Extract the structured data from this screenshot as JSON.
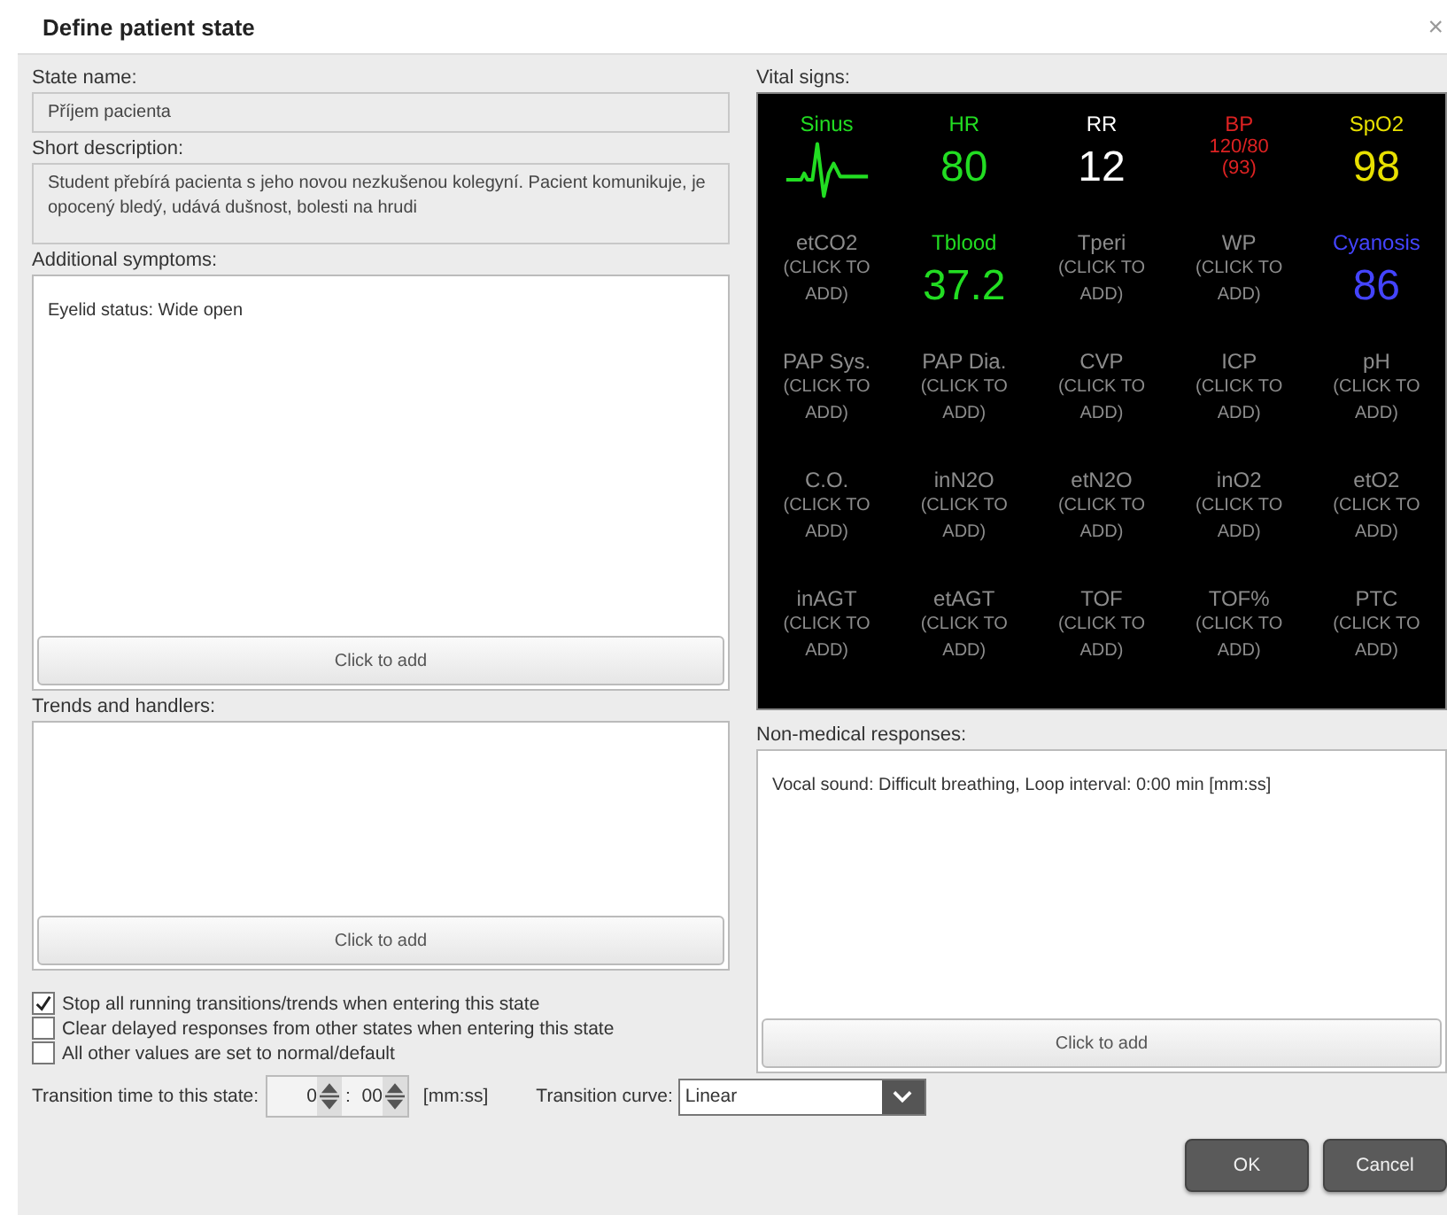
{
  "window": {
    "title": "Define patient state",
    "close": "×"
  },
  "state_name": {
    "label": "State name:",
    "value": "Příjem pacienta"
  },
  "short_description": {
    "label": "Short description:",
    "value": "Student přebírá pacienta s jeho novou nezkušenou kolegyní. Pacient komunikuje, je opocený bledý, udává dušnost, bolesti na hrudi"
  },
  "additional_symptoms": {
    "label": "Additional symptoms:",
    "items": [
      "Eyelid status: Wide open"
    ],
    "button": "Click to add"
  },
  "trends_and_handlers": {
    "label": "Trends and handlers:",
    "button": "Click to add"
  },
  "options": [
    {
      "label": "Stop all running transitions/trends when entering this state",
      "checked": true
    },
    {
      "label": "Clear delayed responses from other states when entering this state",
      "checked": false
    },
    {
      "label": "All other values are set to normal/default",
      "checked": false
    }
  ],
  "transition_time": {
    "label": "Transition time to this state:",
    "minutes": "0",
    "separator": ":",
    "seconds": "00",
    "unit": "[mm:ss]"
  },
  "transition_curve": {
    "label": "Transition curve:",
    "value": "Linear"
  },
  "vital_signs": {
    "label": "Vital signs:",
    "tiles": [
      {
        "kind": "ecg",
        "label": "Sinus",
        "color": "#22dd22"
      },
      {
        "kind": "value",
        "label": "HR",
        "value": "80",
        "color": "#22dd22"
      },
      {
        "kind": "value",
        "label": "RR",
        "value": "12",
        "color": "#ffffff"
      },
      {
        "kind": "pressure",
        "label": "BP",
        "value": "120/80",
        "sub": "(93)",
        "color": "#dd2222"
      },
      {
        "kind": "value",
        "label": "SpO2",
        "value": "98",
        "color": "#e8e000"
      },
      {
        "kind": "empty",
        "label": "etCO2",
        "value": "(CLICK TO ADD)",
        "color": "#8c8c8c"
      },
      {
        "kind": "value",
        "label": "Tblood",
        "value": "37.2",
        "color": "#22dd22"
      },
      {
        "kind": "empty",
        "label": "Tperi",
        "value": "(CLICK TO ADD)",
        "color": "#8c8c8c"
      },
      {
        "kind": "empty",
        "label": "WP",
        "value": "(CLICK TO ADD)",
        "color": "#8c8c8c"
      },
      {
        "kind": "value",
        "label": "Cyanosis",
        "value": "86",
        "color": "#4444ff"
      },
      {
        "kind": "empty",
        "label": "PAP Sys.",
        "value": "(CLICK TO ADD)",
        "color": "#8c8c8c"
      },
      {
        "kind": "empty",
        "label": "PAP Dia.",
        "value": "(CLICK TO ADD)",
        "color": "#8c8c8c"
      },
      {
        "kind": "empty",
        "label": "CVP",
        "value": "(CLICK TO ADD)",
        "color": "#8c8c8c"
      },
      {
        "kind": "empty",
        "label": "ICP",
        "value": "(CLICK TO ADD)",
        "color": "#8c8c8c"
      },
      {
        "kind": "empty",
        "label": "pH",
        "value": "(CLICK TO ADD)",
        "color": "#8c8c8c"
      },
      {
        "kind": "empty",
        "label": "C.O.",
        "value": "(CLICK TO ADD)",
        "color": "#8c8c8c"
      },
      {
        "kind": "empty",
        "label": "inN2O",
        "value": "(CLICK TO ADD)",
        "color": "#8c8c8c"
      },
      {
        "kind": "empty",
        "label": "etN2O",
        "value": "(CLICK TO ADD)",
        "color": "#8c8c8c"
      },
      {
        "kind": "empty",
        "label": "inO2",
        "value": "(CLICK TO ADD)",
        "color": "#8c8c8c"
      },
      {
        "kind": "empty",
        "label": "etO2",
        "value": "(CLICK TO ADD)",
        "color": "#8c8c8c"
      },
      {
        "kind": "empty",
        "label": "inAGT",
        "value": "(CLICK TO ADD)",
        "color": "#8c8c8c"
      },
      {
        "kind": "empty",
        "label": "etAGT",
        "value": "(CLICK TO ADD)",
        "color": "#8c8c8c"
      },
      {
        "kind": "empty",
        "label": "TOF",
        "value": "(CLICK TO ADD)",
        "color": "#8c8c8c"
      },
      {
        "kind": "empty",
        "label": "TOF%",
        "value": "(CLICK TO ADD)",
        "color": "#8c8c8c"
      },
      {
        "kind": "empty",
        "label": "PTC",
        "value": "(CLICK TO ADD)",
        "color": "#8c8c8c"
      }
    ]
  },
  "non_medical_responses": {
    "label": "Non-medical responses:",
    "items": [
      "Vocal sound: Difficult breathing, Loop interval: 0:00 min [mm:ss]"
    ],
    "button": "Click to add"
  },
  "buttons": [
    "OK",
    "Cancel"
  ]
}
